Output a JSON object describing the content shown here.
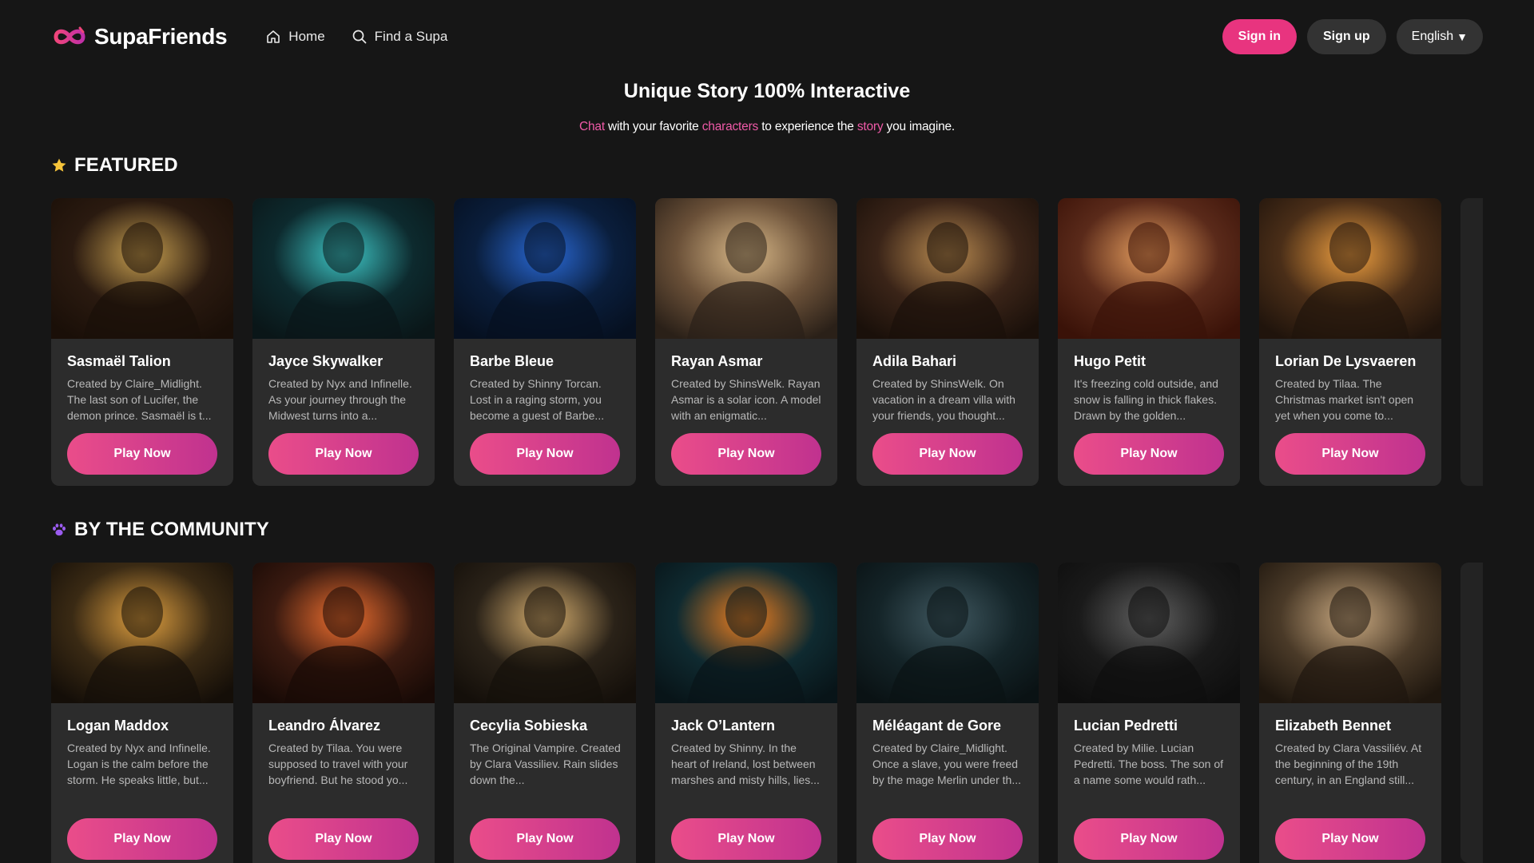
{
  "app": {
    "logo_text": "SupaFriends",
    "accent_color": "#e8347f",
    "nav": {
      "home_label": "Home",
      "find_label": "Find a Supa"
    },
    "actions": {
      "signin_label": "Sign in",
      "signup_label": "Sign up",
      "language_label": "English"
    }
  },
  "hero": {
    "title": "Unique Story 100% Interactive",
    "sub_w1": "Chat",
    "sub_t1": " with your favorite ",
    "sub_w2": "characters",
    "sub_t2": " to experience the ",
    "sub_w3": "story",
    "sub_t3": " you imagine."
  },
  "featured": {
    "title": "FEATURED",
    "icon": "star-icon",
    "cards": [
      {
        "name": "Sasmaël Talion",
        "desc": "Created by Claire_Midlight. The last son of Lucifer, the demon prince. Sasmaël is t...",
        "play": "Play Now"
      },
      {
        "name": "Jayce Skywalker",
        "desc": "Created by Nyx and Infinelle. As your journey through the Midwest turns into a...",
        "play": "Play Now"
      },
      {
        "name": "Barbe Bleue",
        "desc": "Created by Shinny Torcan. Lost in a raging storm, you become a guest of Barbe...",
        "play": "Play Now"
      },
      {
        "name": "Rayan Asmar",
        "desc": "Created by ShinsWelk. Rayan Asmar is a solar icon. A model with an enigmatic...",
        "play": "Play Now"
      },
      {
        "name": "Adila Bahari",
        "desc": "Created by ShinsWelk. On vacation in a dream villa with your friends, you thought...",
        "play": "Play Now"
      },
      {
        "name": "Hugo Petit",
        "desc": "It's freezing cold outside, and snow is falling in thick flakes. Drawn by the golden...",
        "play": "Play Now"
      },
      {
        "name": "Lorian De Lysvaeren",
        "desc": "Created by Tilaa. The Christmas market isn't open yet when you come to...",
        "play": "Play Now"
      }
    ]
  },
  "community": {
    "title": "BY THE COMMUNITY",
    "icon": "paw-icon",
    "cards": [
      {
        "name": "Logan Maddox",
        "desc": "Created by Nyx and Infinelle. Logan is the calm before the storm. He speaks little, but...",
        "play": "Play Now"
      },
      {
        "name": "Leandro Álvarez",
        "desc": "Created by Tilaa. You were supposed to travel with your boyfriend. But he stood yo...",
        "play": "Play Now"
      },
      {
        "name": "Cecylia Sobieska",
        "desc": "The Original Vampire. Created by Clara Vassiliev. Rain slides down the...",
        "play": "Play Now"
      },
      {
        "name": "Jack O’Lantern",
        "desc": "Created by Shinny. In the heart of Ireland, lost between marshes and misty hills, lies...",
        "play": "Play Now"
      },
      {
        "name": "Méléagant de Gore",
        "desc": "Created by Claire_Midlight. Once a slave, you were freed by the mage Merlin under th...",
        "play": "Play Now"
      },
      {
        "name": "Lucian Pedretti",
        "desc": "Created by Milie. Lucian Pedretti. The boss. The son of a name some would rath...",
        "play": "Play Now"
      },
      {
        "name": "Elizabeth Bennet",
        "desc": "Created by Clara Vassiliév. At the beginning of the 19th century, in an England still...",
        "play": "Play Now"
      }
    ]
  }
}
